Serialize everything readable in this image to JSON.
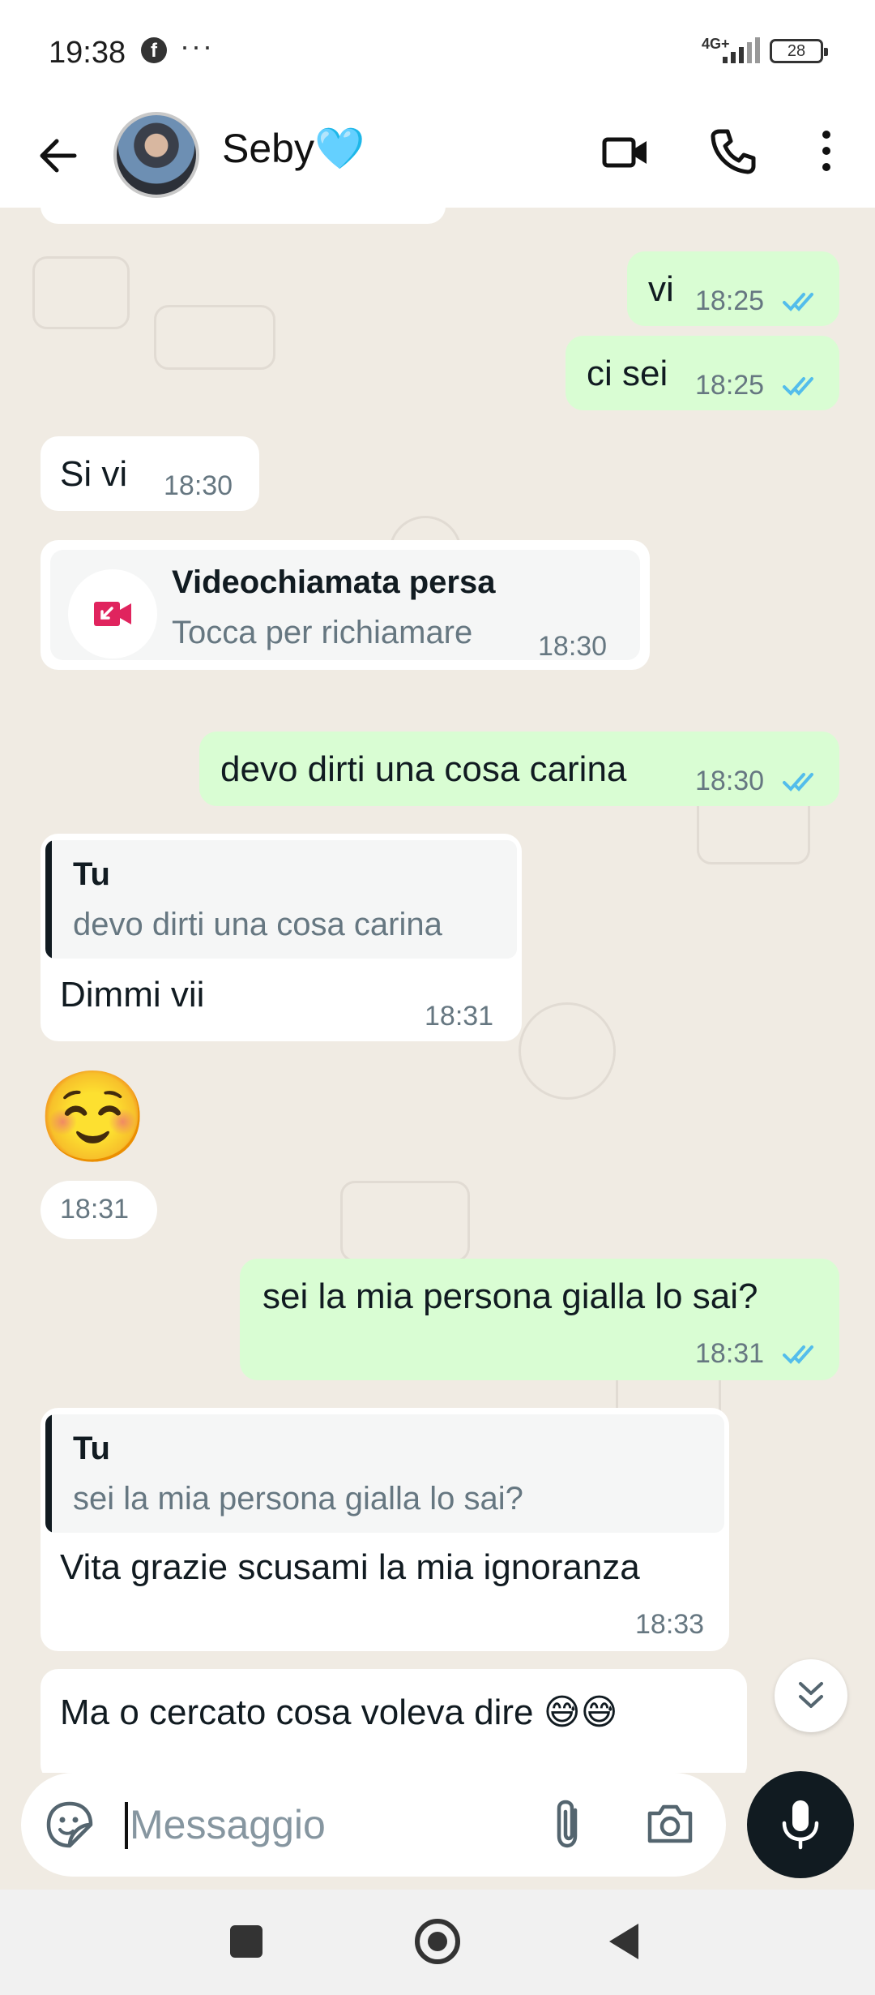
{
  "status_bar": {
    "time": "19:38",
    "notification_icons": [
      "facebook-icon",
      "more-dots-icon"
    ],
    "network": "4G+",
    "battery": "28"
  },
  "header": {
    "contact_name": "Seby🩵",
    "icons": [
      "back-arrow-icon",
      "avatar",
      "video-call-icon",
      "phone-call-icon",
      "more-vertical-icon"
    ]
  },
  "messages": [
    {
      "direction": "out",
      "text": "vi",
      "time": "18:25",
      "status": "read"
    },
    {
      "direction": "out",
      "text": "ci sei",
      "time": "18:25",
      "status": "read"
    },
    {
      "direction": "in",
      "text": "Si vi",
      "time": "18:30"
    },
    {
      "direction": "in",
      "type": "missed_video_call",
      "title": "Videochiamata persa",
      "subtitle": "Tocca per richiamare",
      "time": "18:30"
    },
    {
      "direction": "out",
      "text": "devo dirti una cosa carina",
      "time": "18:30",
      "status": "read"
    },
    {
      "direction": "in",
      "quote_author": "Tu",
      "quote_text": "devo dirti una cosa carina",
      "text": "Dimmi vii",
      "time": "18:31"
    },
    {
      "direction": "in",
      "type": "emoji",
      "text": "☺️",
      "time": "18:31"
    },
    {
      "direction": "out",
      "text": "sei la mia persona gialla lo sai?",
      "time": "18:31",
      "status": "read"
    },
    {
      "direction": "in",
      "quote_author": "Tu",
      "quote_text": "sei la mia persona gialla lo sai?",
      "text": "Vita grazie scusami la mia ignoranza",
      "time": "18:33"
    },
    {
      "direction": "in",
      "text": "Ma o cercato cosa voleva dire 😅😅",
      "time": ""
    }
  ],
  "input": {
    "placeholder": "Messaggio",
    "value": ""
  },
  "colors": {
    "outgoing_bubble": "#d9fdd3",
    "incoming_bubble": "#ffffff",
    "wallpaper": "#f0ebe3",
    "read_ticks": "#53bdeb",
    "missed_call": "#e0245e"
  }
}
